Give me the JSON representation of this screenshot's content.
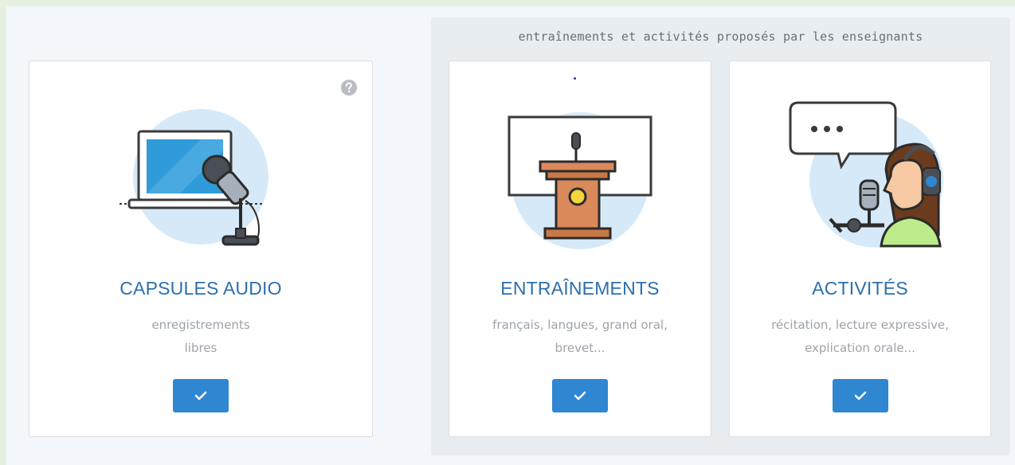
{
  "group": {
    "caption": "entraînements et activités proposés par les enseignants"
  },
  "cards": [
    {
      "id": "capsules-audio",
      "title": "CAPSULES AUDIO",
      "description": [
        "enregistrements",
        "libres"
      ],
      "illustration": "laptop-microphone-icon"
    },
    {
      "id": "entrainements",
      "title": "ENTRAÎNEMENTS",
      "description": [
        "français, langues, grand oral,",
        "brevet..."
      ],
      "illustration": "podium-screen-icon"
    },
    {
      "id": "activites",
      "title": "ACTIVITÉS",
      "description": [
        "récitation, lecture expressive,",
        "explication orale..."
      ],
      "illustration": "speaker-headphones-icon"
    }
  ],
  "icons": {
    "help": "question-circle-icon",
    "select": "check-icon"
  },
  "colors": {
    "accent": "#2f86d1",
    "title": "#2c6fad",
    "muted_text": "#9ea3a8",
    "illustration_circle": "#d6e9f8"
  }
}
